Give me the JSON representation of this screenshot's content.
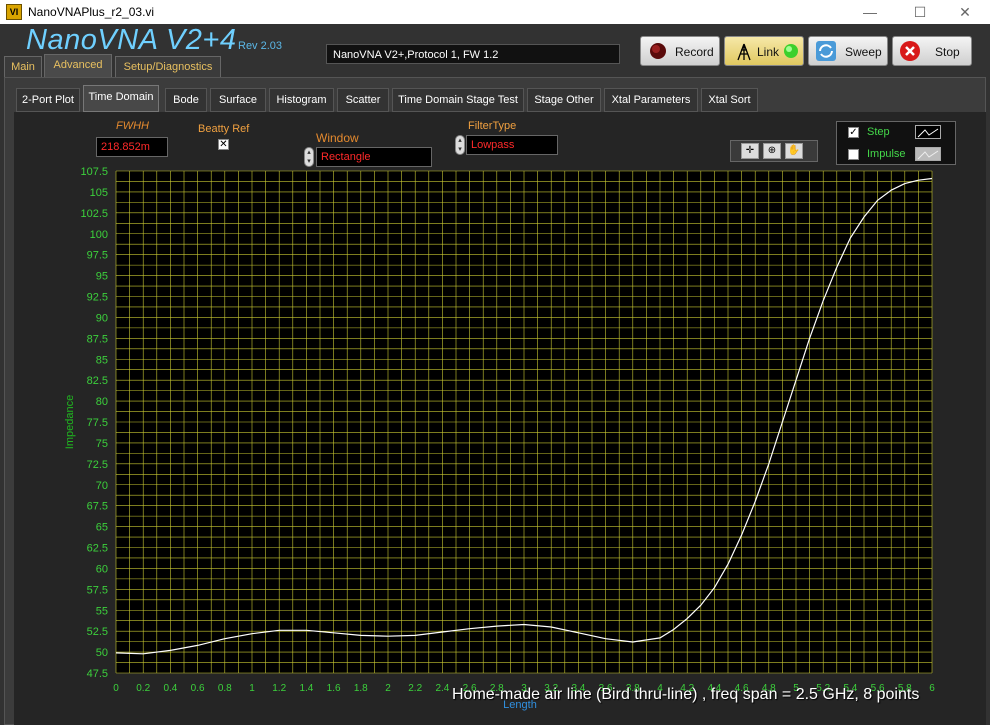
{
  "window": {
    "title": "NanoVNAPlus_r2_03.vi",
    "app_icon": "labview-vi-icon",
    "minimize": "—",
    "maximize": "☐",
    "close": "✕"
  },
  "header": {
    "brand": "NanoVNA V2+4",
    "rev": "Rev 2.03",
    "device_status": "NanoVNA V2+,Protocol 1, FW 1.2",
    "record_label": "Record",
    "link_label": "Link",
    "sweep_label": "Sweep",
    "stop_label": "Stop"
  },
  "top_tabs": [
    {
      "label": "Main",
      "active": false
    },
    {
      "label": "Advanced",
      "active": true
    },
    {
      "label": "Setup/Diagnostics",
      "active": false
    }
  ],
  "sub_tabs": [
    {
      "label": "2-Port Plot",
      "active": false
    },
    {
      "label": "Time Domain",
      "active": true
    },
    {
      "label": "Bode",
      "active": false
    },
    {
      "label": "Surface",
      "active": false
    },
    {
      "label": "Histogram",
      "active": false
    },
    {
      "label": "Scatter",
      "active": false
    },
    {
      "label": "Time Domain Stage Test",
      "active": false
    },
    {
      "label": "Stage Other",
      "active": false
    },
    {
      "label": "Xtal Parameters",
      "active": false
    },
    {
      "label": "Xtal Sort",
      "active": false
    }
  ],
  "controls": {
    "fwhh_label": "FWHH",
    "fwhh_value": "218.852m",
    "beatty_label": "Beatty Ref",
    "beatty_checked": true,
    "window_label": "Window",
    "window_value": "Rectangle",
    "filter_label": "FilterType",
    "filter_value": "Lowpass"
  },
  "legend": [
    {
      "label": "Step",
      "checked": true
    },
    {
      "label": "Impulse",
      "checked": false
    }
  ],
  "caption": "Home-made air line (Bird thru-line) , freq span = 2.5 GHz, 8 points",
  "colors": {
    "plot_bg": "#000000",
    "grid": "#c8c832",
    "trace": "#ffffff",
    "tick": "#3cd03c",
    "axis_label": "#20b820"
  },
  "chart_data": {
    "type": "line",
    "xlabel": "Length",
    "ylabel": "Impedance",
    "xlim": [
      0,
      6
    ],
    "ylim": [
      47.5,
      107.5
    ],
    "x_ticks": [
      "0",
      "0.2",
      "0.4",
      "0.6",
      "0.8",
      "1",
      "1.2",
      "1.4",
      "1.6",
      "1.8",
      "2",
      "2.2",
      "2.4",
      "2.6",
      "2.8",
      "3",
      "3.2",
      "3.4",
      "3.6",
      "3.8",
      "4",
      "4.2",
      "4.4",
      "4.6",
      "4.8",
      "5",
      "5.2",
      "5.4",
      "5.6",
      "5.8",
      "6"
    ],
    "y_ticks": [
      "47.5",
      "50",
      "52.5",
      "55",
      "57.5",
      "60",
      "62.5",
      "65",
      "67.5",
      "70",
      "72.5",
      "75",
      "77.5",
      "80",
      "82.5",
      "85",
      "87.5",
      "90",
      "92.5",
      "95",
      "97.5",
      "100",
      "102.5",
      "105",
      "107.5"
    ],
    "grid": true,
    "series": [
      {
        "x": [
          0,
          0.2,
          0.4,
          0.6,
          0.8,
          1.0,
          1.2,
          1.4,
          1.6,
          1.8,
          2.0,
          2.2,
          2.4,
          2.6,
          2.8,
          3.0,
          3.2,
          3.4,
          3.6,
          3.8,
          4.0,
          4.1,
          4.2,
          4.3,
          4.4,
          4.5,
          4.6,
          4.7,
          4.8,
          4.9,
          5.0,
          5.1,
          5.2,
          5.3,
          5.4,
          5.5,
          5.6,
          5.7,
          5.8,
          5.9,
          6.0
        ],
        "y": [
          49.9,
          49.8,
          50.2,
          50.8,
          51.6,
          52.2,
          52.6,
          52.6,
          52.3,
          52.0,
          51.9,
          52.0,
          52.4,
          52.8,
          53.1,
          53.3,
          53.0,
          52.3,
          51.6,
          51.2,
          51.7,
          52.7,
          54.0,
          55.6,
          57.7,
          60.5,
          64.0,
          68.0,
          72.5,
          77.5,
          82.5,
          87.5,
          92.0,
          96.0,
          99.5,
          102.0,
          104.0,
          105.2,
          106.0,
          106.4,
          106.6
        ]
      }
    ]
  }
}
